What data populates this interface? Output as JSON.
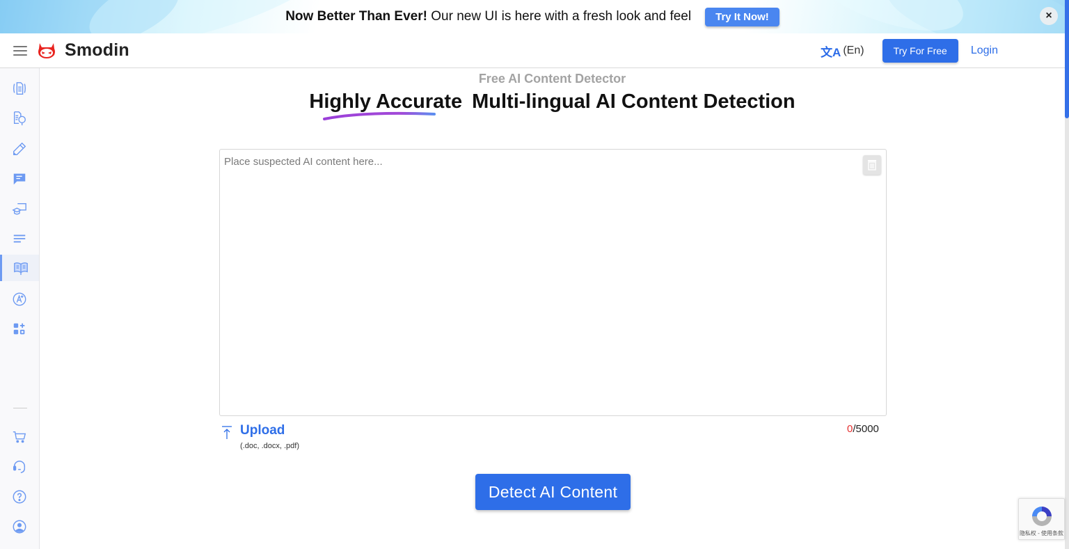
{
  "banner": {
    "headline": "Now Better Than Ever!",
    "text": " Our new UI is here with a fresh look and feel",
    "cta_label": "Try It Now!",
    "close_label": "×"
  },
  "header": {
    "brand": "Smodin",
    "language": "(En)",
    "language_icon": "translate-icon",
    "try_free_label": "Try For Free",
    "login_label": "Login"
  },
  "sidebar": {
    "items": [
      {
        "id": "rewriter",
        "icon": "document-rewrite-icon"
      },
      {
        "id": "plagiarism-checker",
        "icon": "document-search-icon"
      },
      {
        "id": "writer",
        "icon": "pen-icon"
      },
      {
        "id": "chat",
        "icon": "chat-icon"
      },
      {
        "id": "homework",
        "icon": "graduation-board-icon"
      },
      {
        "id": "summarizer",
        "icon": "lines-icon"
      },
      {
        "id": "ai-detector",
        "icon": "book-detector-icon",
        "active": true
      },
      {
        "id": "grader",
        "icon": "grade-a-plus-icon"
      },
      {
        "id": "more-apps",
        "icon": "apps-plus-icon"
      }
    ],
    "bottom_items": [
      {
        "id": "cart",
        "icon": "cart-icon"
      },
      {
        "id": "support",
        "icon": "headset-icon"
      },
      {
        "id": "help",
        "icon": "help-icon"
      },
      {
        "id": "account",
        "icon": "user-icon"
      }
    ]
  },
  "main": {
    "subtitle": "Free AI Content Detector",
    "headline_highlight": "Highly Accurate",
    "headline_rest": "Multi-lingual AI Content Detection",
    "editor": {
      "placeholder": "Place suspected AI content here...",
      "value": ""
    },
    "upload": {
      "label": "Upload",
      "types": "(.doc, .docx, .pdf)"
    },
    "counter": {
      "current": "0",
      "separator": "/",
      "max": "5000"
    },
    "detect_label": "Detect AI Content"
  },
  "recaptcha": {
    "text": "隐私权 - 使用条款"
  },
  "colors": {
    "accent": "#2e6ee8",
    "logo_red": "#e8231f",
    "sidebar_icon": "#6d9af2",
    "counter_current": "#e53030"
  }
}
